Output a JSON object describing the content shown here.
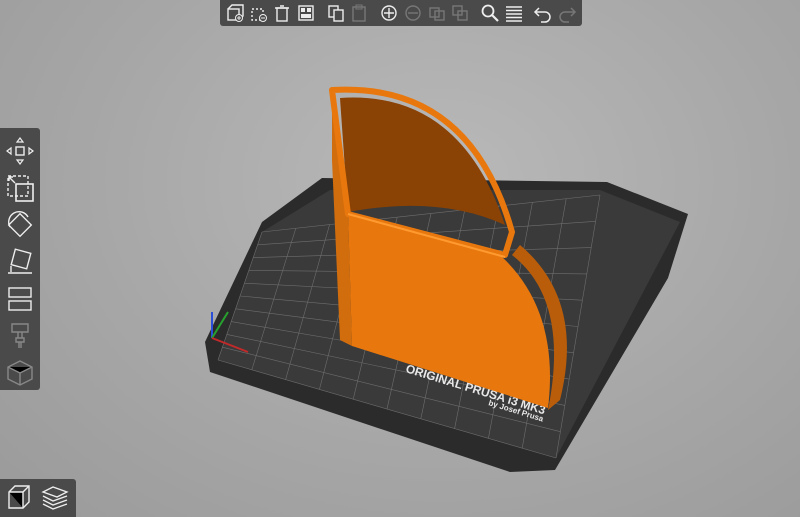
{
  "toolbar": {
    "items": [
      {
        "name": "add-icon",
        "enabled": true
      },
      {
        "name": "delete-icon",
        "enabled": true
      },
      {
        "name": "delete-all-icon",
        "enabled": true
      },
      {
        "name": "arrange-icon",
        "enabled": true
      },
      {
        "name": "copy-icon",
        "enabled": true
      },
      {
        "name": "paste-icon",
        "enabled": false
      },
      {
        "name": "add-instance-icon",
        "enabled": true
      },
      {
        "name": "remove-instance-icon",
        "enabled": false
      },
      {
        "name": "split-objects-icon",
        "enabled": false
      },
      {
        "name": "split-parts-icon",
        "enabled": false
      },
      {
        "name": "search-icon",
        "enabled": true
      },
      {
        "name": "layers-editing-icon",
        "enabled": true
      },
      {
        "name": "undo-icon",
        "enabled": true
      },
      {
        "name": "redo-icon",
        "enabled": false
      }
    ]
  },
  "gizmos": [
    "move-icon",
    "scale-icon",
    "rotate-icon",
    "place-on-face-icon",
    "cut-icon",
    "supports-icon",
    "seam-icon"
  ],
  "view_toggle": [
    "view-3d-icon",
    "view-preview-icon"
  ],
  "bed": {
    "brand_line1": "ORIGINAL PRUSA i3  MK3",
    "brand_line2": "by Josef Prusa"
  },
  "colors": {
    "panel": "#4a4a4a",
    "model": "#e8780e",
    "bed": "#2f2f2f",
    "grid": "#8a8a8a"
  }
}
